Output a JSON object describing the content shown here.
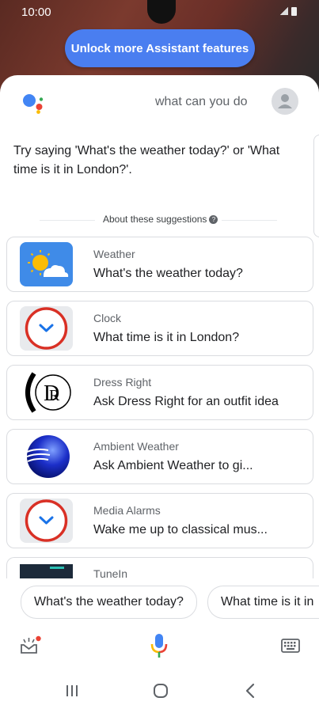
{
  "status": {
    "time": "10:00"
  },
  "banner": {
    "unlock_label": "Unlock more Assistant features"
  },
  "header": {
    "query": "what can you do"
  },
  "intro": {
    "text": "Try saying 'What's the weather today?' or 'What time is it in London?'."
  },
  "about": {
    "label": "About these suggestions"
  },
  "cards": [
    {
      "category": "Weather",
      "title": "What's the weather today?"
    },
    {
      "category": "Clock",
      "title": "What time is it in London?"
    },
    {
      "category": "Dress Right",
      "title": "Ask Dress Right for an outfit idea"
    },
    {
      "category": "Ambient Weather",
      "title": "Ask Ambient Weather to gi..."
    },
    {
      "category": "Media Alarms",
      "title": "Wake me up to classical mus..."
    },
    {
      "category": "TuneIn",
      "title": ""
    }
  ],
  "chips": [
    {
      "label": "What's the weather today?"
    },
    {
      "label": "What time is it in"
    }
  ],
  "icons": {
    "logo": "google-assistant-logo",
    "explore": "explore-icon",
    "mic": "microphone-icon",
    "keyboard": "keyboard-icon"
  },
  "colors": {
    "accent": "#4a7ef0",
    "mic_red": "#ea4335",
    "mic_blue": "#4285f4",
    "mic_yellow": "#fbbc05",
    "mic_green": "#34a853"
  }
}
